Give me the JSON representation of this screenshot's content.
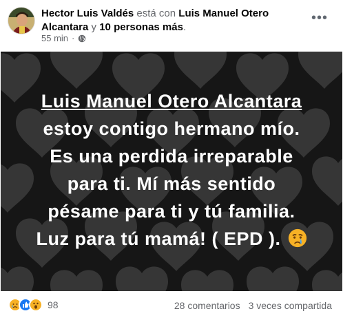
{
  "post": {
    "author": "Hector Luis Valdés",
    "with_text": "está con",
    "tagged": "Luis Manuel Otero Alcantara",
    "and_text": "y",
    "others": "10 personas más",
    "period": ".",
    "time": "55 min",
    "privacy_icon": "globe-icon",
    "more_icon": "more-dots-icon",
    "more_label": "•••"
  },
  "image": {
    "line1": "Luis Manuel Otero Alcantara",
    "line2": "estoy contigo hermano mío.",
    "line3": "Es una perdida irreparable",
    "line4": "para ti. Mí más sentido",
    "line5": "pésame para ti y tú familia.",
    "line6": "Luz para tú mamá! ( EPD ).",
    "emoji": "crying-face-emoji",
    "background": "dark heart pattern"
  },
  "reactions": {
    "icons": [
      "sad-face-icon",
      "like-icon",
      "wow-face-icon"
    ],
    "count": "98"
  },
  "stats": {
    "comments": "28 comentarios",
    "shares": "3 veces compartida"
  },
  "colors": {
    "meta_text": "#65676b",
    "name_text": "#050505",
    "image_bg": "#161616",
    "heart": "#3a3a3a",
    "like_blue": "#1877f2",
    "sad_yellow": "#f7b125"
  }
}
